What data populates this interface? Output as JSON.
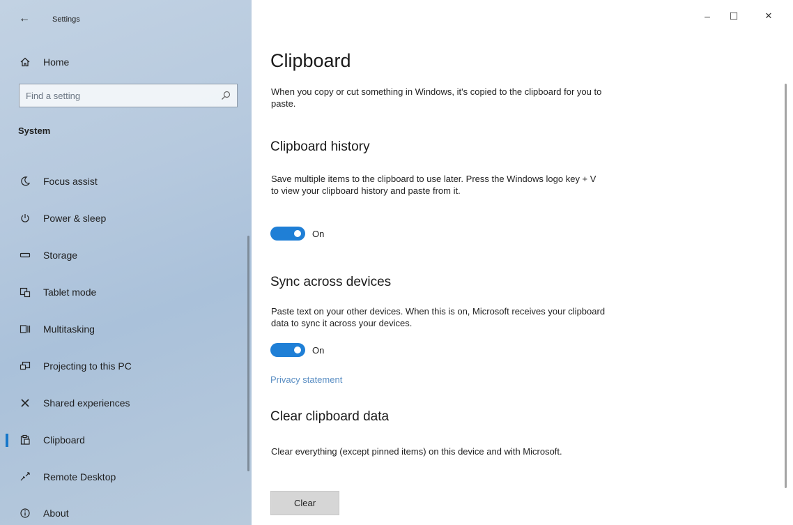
{
  "app": {
    "title": "Settings"
  },
  "window_controls": {
    "minimize_glyph": "–",
    "maximize_glyph": "☐",
    "close_glyph": "✕"
  },
  "sidebar": {
    "home_label": "Home",
    "search": {
      "placeholder": "Find a setting",
      "value": "",
      "icon": "search-icon"
    },
    "section_title": "System",
    "items": [
      {
        "label": "Focus assist",
        "icon": "moon-icon"
      },
      {
        "label": "Power & sleep",
        "icon": "power-icon"
      },
      {
        "label": "Storage",
        "icon": "storage-icon"
      },
      {
        "label": "Tablet mode",
        "icon": "tablet-mode-icon"
      },
      {
        "label": "Multitasking",
        "icon": "multitasking-icon"
      },
      {
        "label": "Projecting to this PC",
        "icon": "projecting-icon"
      },
      {
        "label": "Shared experiences",
        "icon": "shared-experiences-icon"
      },
      {
        "label": "Clipboard",
        "icon": "clipboard-icon",
        "active": true
      },
      {
        "label": "Remote Desktop",
        "icon": "remote-desktop-icon"
      },
      {
        "label": "About",
        "icon": "info-icon"
      }
    ]
  },
  "main": {
    "title": "Clipboard",
    "intro": "When you copy or cut something in Windows, it's copied to the clipboard for you to paste.",
    "history": {
      "heading": "Clipboard history",
      "description": "Save multiple items to the clipboard to use later. Press the Windows logo key + V to view your clipboard history and paste from it.",
      "toggle_label": "On",
      "toggle_on": true
    },
    "sync": {
      "heading": "Sync across devices",
      "description": "Paste text on your other devices. When this is on, Microsoft receives your clipboard data to sync it across your devices.",
      "toggle_label": "On",
      "toggle_on": true,
      "privacy_link": "Privacy statement"
    },
    "clear": {
      "heading": "Clear clipboard data",
      "description": "Clear everything (except pinned items) on this device and with Microsoft.",
      "button_label": "Clear"
    }
  },
  "colors": {
    "accent": "#1f7fd6",
    "link": "#5a8ec3",
    "sidebar_bg": "#b6c9de"
  }
}
